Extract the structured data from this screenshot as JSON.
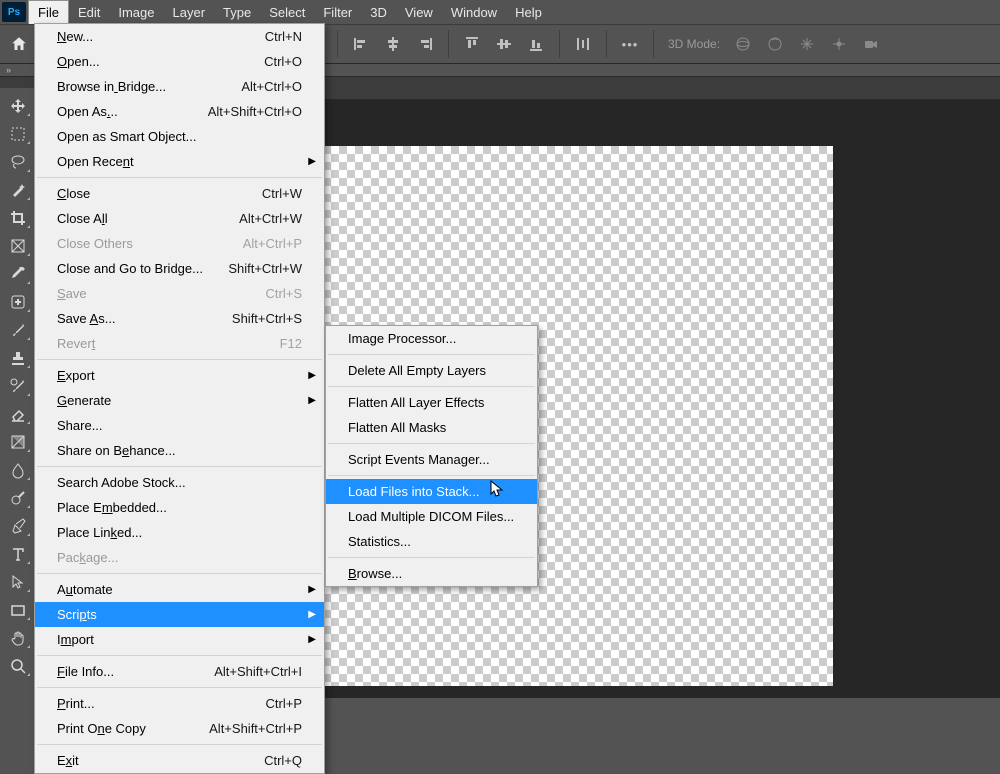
{
  "menubar": {
    "items": [
      "File",
      "Edit",
      "Image",
      "Layer",
      "Type",
      "Select",
      "Filter",
      "3D",
      "View",
      "Window",
      "Help"
    ],
    "open_index": 0
  },
  "optionsbar": {
    "mode_label": "3D Mode:"
  },
  "file_menu": {
    "groups": [
      [
        {
          "label": "New...",
          "u": 0,
          "shortcut": "Ctrl+N"
        },
        {
          "label": "Open...",
          "u": 0,
          "shortcut": "Ctrl+O"
        },
        {
          "label": "Browse in Bridge...",
          "u": 9,
          "shortcut": "Alt+Ctrl+O"
        },
        {
          "label": "Open As...",
          "u": 7,
          "shortcut": "Alt+Shift+Ctrl+O"
        },
        {
          "label": "Open as Smart Object..."
        },
        {
          "label": "Open Recent",
          "u": 9,
          "submenu": true
        }
      ],
      [
        {
          "label": "Close",
          "u": 0,
          "shortcut": "Ctrl+W"
        },
        {
          "label": "Close All",
          "u": 7,
          "shortcut": "Alt+Ctrl+W"
        },
        {
          "label": "Close Others",
          "shortcut": "Alt+Ctrl+P",
          "disabled": true
        },
        {
          "label": "Close and Go to Bridge...",
          "shortcut": "Shift+Ctrl+W"
        },
        {
          "label": "Save",
          "u": 0,
          "shortcut": "Ctrl+S",
          "disabled": true
        },
        {
          "label": "Save As...",
          "u": 5,
          "shortcut": "Shift+Ctrl+S"
        },
        {
          "label": "Revert",
          "u": 5,
          "shortcut": "F12",
          "disabled": true
        }
      ],
      [
        {
          "label": "Export",
          "u": 0,
          "submenu": true
        },
        {
          "label": "Generate",
          "u": 0,
          "submenu": true
        },
        {
          "label": "Share..."
        },
        {
          "label": "Share on Behance...",
          "u": 10
        }
      ],
      [
        {
          "label": "Search Adobe Stock..."
        },
        {
          "label": "Place Embedded...",
          "u": 7
        },
        {
          "label": "Place Linked...",
          "u": 9
        },
        {
          "label": "Package...",
          "u": 3,
          "disabled": true
        }
      ],
      [
        {
          "label": "Automate",
          "u": 1,
          "submenu": true
        },
        {
          "label": "Scripts",
          "u": 4,
          "submenu": true,
          "highlight": true
        },
        {
          "label": "Import",
          "u": 1,
          "submenu": true
        }
      ],
      [
        {
          "label": "File Info...",
          "u": 0,
          "shortcut": "Alt+Shift+Ctrl+I"
        }
      ],
      [
        {
          "label": "Print...",
          "u": 0,
          "shortcut": "Ctrl+P"
        },
        {
          "label": "Print One Copy",
          "u": 7,
          "shortcut": "Alt+Shift+Ctrl+P"
        }
      ],
      [
        {
          "label": "Exit",
          "u": 1,
          "shortcut": "Ctrl+Q"
        }
      ]
    ]
  },
  "scripts_menu": {
    "groups": [
      [
        {
          "label": "Image Processor..."
        }
      ],
      [
        {
          "label": "Delete All Empty Layers"
        }
      ],
      [
        {
          "label": "Flatten All Layer Effects"
        },
        {
          "label": "Flatten All Masks"
        }
      ],
      [
        {
          "label": "Script Events Manager..."
        }
      ],
      [
        {
          "label": "Load Files into Stack...",
          "highlight": true
        },
        {
          "label": "Load Multiple DICOM Files..."
        },
        {
          "label": "Statistics..."
        }
      ],
      [
        {
          "label": "Browse...",
          "u": 0
        }
      ]
    ]
  },
  "tools": [
    "move",
    "marquee",
    "lasso",
    "wand",
    "crop",
    "frame",
    "eyedropper",
    "healing",
    "brush",
    "stamp",
    "history-brush",
    "eraser",
    "gradient",
    "blur",
    "dodge",
    "pen",
    "type",
    "path-select",
    "rectangle",
    "hand",
    "zoom"
  ]
}
